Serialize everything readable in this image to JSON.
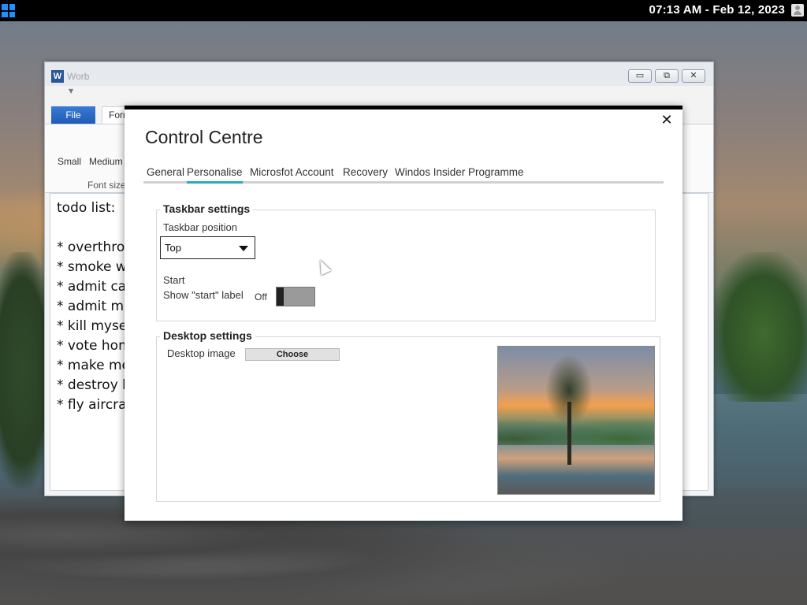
{
  "topbar": {
    "clock": "07:13 AM - Feb 12, 2023"
  },
  "word": {
    "title": "Worb",
    "file_tab": "File",
    "format_tab": "Forr",
    "ribbon": {
      "small": "Small",
      "medium": "Medium",
      "group_label": "Font size"
    },
    "document_lines": [
      "todo list:",
      "",
      "* overthrov",
      "* smoke we",
      "* admit car",
      "* admit me",
      "* kill mysel",
      "* vote hom",
      "* make me",
      "* destroy b",
      "* fly aircraf"
    ],
    "buttons": {
      "minimize": "▭",
      "maximize": "⧉",
      "close": "✕"
    }
  },
  "control_centre": {
    "title": "Control Centre",
    "close": "✕",
    "tabs": [
      {
        "label": "General"
      },
      {
        "label": "Personalise"
      },
      {
        "label": "Microsfot Account"
      },
      {
        "label": "Recovery"
      },
      {
        "label": "Windos Insider Programme"
      }
    ],
    "active_tab": "Personalise",
    "taskbar": {
      "legend": "Taskbar settings",
      "position_label": "Taskbar position",
      "position_value": "Top",
      "start_label": "Start",
      "show_start_label": "Show \"start\" label",
      "toggle_state": "Off"
    },
    "desktop": {
      "legend": "Desktop settings",
      "image_label": "Desktop image",
      "choose_button": "Choose"
    }
  },
  "icons": {
    "start": "windows-logo-icon",
    "user": "user-icon",
    "word": "word-app-icon"
  },
  "colors": {
    "accent": "#2aa9c5",
    "file_tab": "#1e5bb5",
    "windows_logo": "#1e90ff"
  }
}
